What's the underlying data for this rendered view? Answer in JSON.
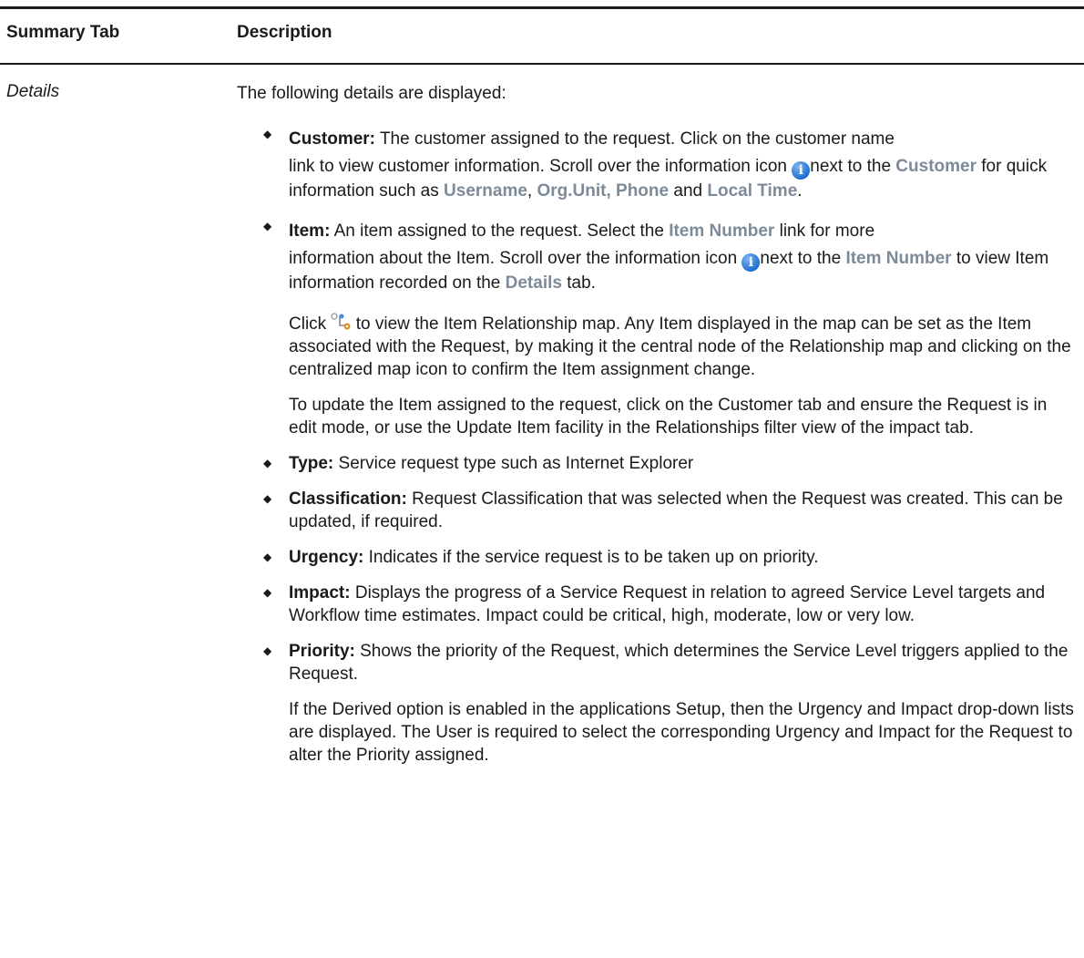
{
  "header": {
    "col1": "Summary Tab",
    "col2": "Description"
  },
  "row": {
    "label": "Details",
    "intro": "The following details are displayed:",
    "customer": {
      "term": "Customer:",
      "t1": " The customer assigned to the request. Click on the customer name",
      "t2": "link to view customer information. Scroll over the information icon ",
      "t3": "next to the ",
      "ui1": "Customer",
      "t4": " for quick information such as ",
      "ui2": "Username",
      "t5": ", ",
      "ui3": "Org.Unit, Phone",
      "t6": " and ",
      "ui4": "Local Time",
      "t7": "."
    },
    "item": {
      "term": "Item:",
      "t1": " An item assigned to the request. Select the ",
      "ui1": "Item Number",
      "t2": " link for more",
      "t3": "information about the Item. Scroll over the information icon ",
      "t4": "next to the ",
      "ui2": "Item Number",
      "t5": " to view Item information recorded on the ",
      "ui3": "Details",
      "t6": " tab.",
      "p2a": "Click ",
      "p2b": " to view the Item Relationship map. Any Item displayed in the map can be set as the Item associated with the Request, by making it the central node of the Relationship map and clicking on the centralized map icon to confirm the Item assignment change.",
      "p3": "To update the Item assigned to the request, click on the Customer tab and ensure the Request is in edit mode, or use the Update Item facility in the Relationships filter view of the impact tab."
    },
    "type": {
      "term": "Type:",
      "text": " Service request type such as Internet Explorer"
    },
    "classification": {
      "term": "Classification:",
      "text": " Request Classification that was selected when the Request was created. This can be updated, if required."
    },
    "urgency": {
      "term": "Urgency:",
      "text": " Indicates if the service request is to be taken up on priority."
    },
    "impact": {
      "term": "Impact:",
      "text": " Displays the progress of a Service Request in relation to agreed Service Level targets and Workflow time estimates. Impact could be critical, high, moderate, low or very low."
    },
    "priority": {
      "term": "Priority:",
      "text": " Shows the priority of the Request, which determines the Service Level triggers applied to the Request.",
      "p2": "If the Derived option is enabled in the applications Setup, then the Urgency and Impact drop-down lists are displayed. The User is required to select the corresponding Urgency and Impact for the Request to alter the Priority assigned."
    },
    "bullet_glyph": "◆",
    "info_glyph": "i",
    "icons": {
      "info": "info-icon",
      "relationship_map": "relationship-map-icon"
    }
  }
}
